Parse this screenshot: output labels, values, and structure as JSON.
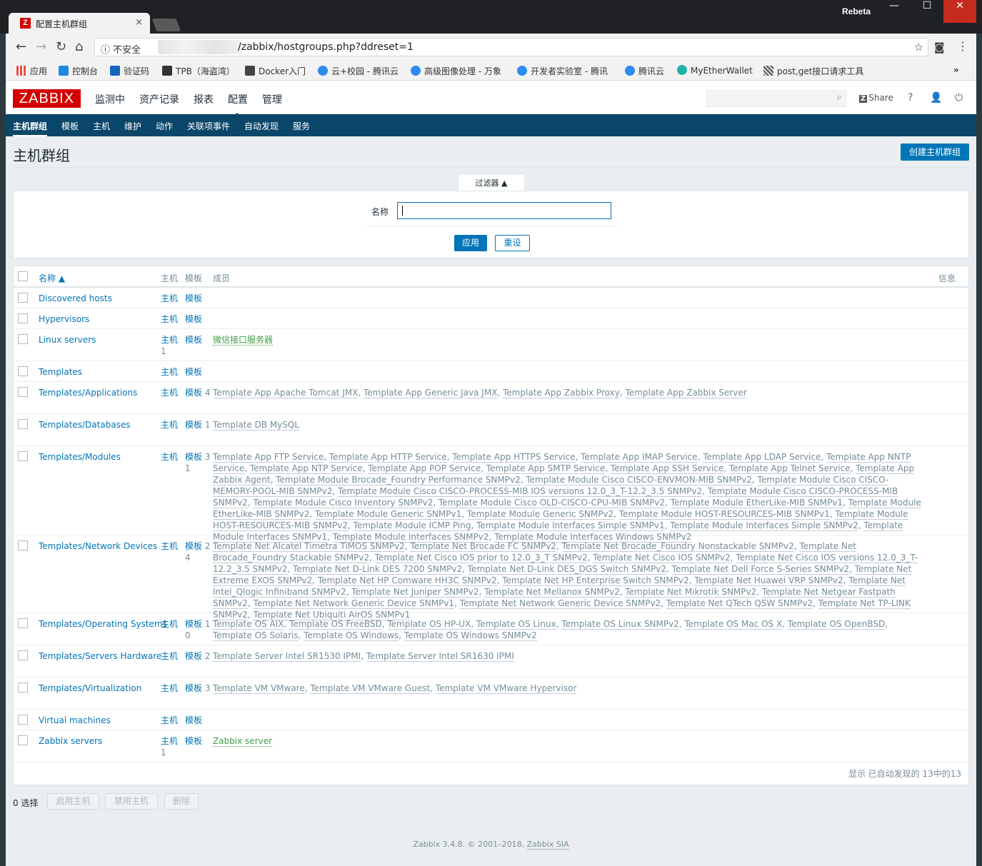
{
  "browser": {
    "tab_title": "配置主机群组",
    "tab_close": "×",
    "window_user": "Rebeta",
    "win_min": "—",
    "win_max": "☐",
    "win_close": "✕",
    "security_label": "不安全",
    "url": "/zabbix/hostgroups.php?ddreset=1",
    "bookmarks": [
      {
        "label": "应用",
        "color": "#e84a3c"
      },
      {
        "label": "控制台",
        "color": "#1e88e5"
      },
      {
        "label": "验证码",
        "color": "#1565c0"
      },
      {
        "label": "TPB（海盗湾）",
        "color": "#333333"
      },
      {
        "label": "Docker入门",
        "color": "#444444"
      },
      {
        "label": "云+校园 - 腾讯云",
        "color": "#2d8cf0"
      },
      {
        "label": "高级图像处理 - 万象",
        "color": "#2d8cf0"
      },
      {
        "label": "开发者实验室 - 腾讯",
        "color": "#2d8cf0"
      },
      {
        "label": "腾讯云",
        "color": "#2d8cf0"
      },
      {
        "label": "MyEtherWallet",
        "color": "#20b2aa"
      },
      {
        "label": "post,get接口请求工具",
        "color": "#555555"
      }
    ],
    "bookmarks_more": "»"
  },
  "header": {
    "logo": "ZABBIX",
    "menu": [
      "监测中",
      "资产记录",
      "报表",
      "配置",
      "管理"
    ],
    "active_menu": "配置",
    "share_badge": "Z",
    "share_label": "Share",
    "help": "?",
    "user": "👤",
    "logout": "⏻"
  },
  "subnav": {
    "items": [
      "主机群组",
      "模板",
      "主机",
      "维护",
      "动作",
      "关联项事件",
      "自动发现",
      "服务"
    ],
    "active": "主机群组"
  },
  "page": {
    "title": "主机群组",
    "create_button": "创建主机群组"
  },
  "filter": {
    "tab_label": "过滤器 ▲",
    "name_label": "名称",
    "name_value": "",
    "apply": "应用",
    "reset": "重设"
  },
  "table": {
    "headers": {
      "name": "名称 ▲",
      "hosts": "主机",
      "templates": "模板",
      "members": "成员",
      "info": "信息"
    },
    "rows": [
      {
        "name": "Discovered hosts",
        "hosts": "主机",
        "templates": "模板",
        "members": []
      },
      {
        "name": "Hypervisors",
        "hosts": "主机",
        "templates": "模板",
        "members": []
      },
      {
        "name": "Linux servers",
        "hosts": "主机",
        "host_count": "1",
        "templates": "模板",
        "members": [
          "微信接口服务器"
        ],
        "green": true
      },
      {
        "name": "Templates",
        "hosts": "主机",
        "templates": "模板",
        "members": []
      },
      {
        "name": "Templates/Applications",
        "hosts": "主机",
        "templates": "模板",
        "tpl_count": "4",
        "members": [
          "Template App Apache Tomcat JMX",
          "Template App Generic Java JMX",
          "Template App Zabbix Proxy",
          "Template App Zabbix Server"
        ]
      },
      {
        "name": "Templates/Databases",
        "hosts": "主机",
        "templates": "模板",
        "tpl_count": "1",
        "members": [
          "Template DB MySQL"
        ]
      },
      {
        "name": "Templates/Modules",
        "hosts": "主机",
        "templates": "模板",
        "tpl_count": "31",
        "members": [
          "Template App FTP Service",
          "Template App HTTP Service",
          "Template App HTTPS Service",
          "Template App IMAP Service",
          "Template App LDAP Service",
          "Template App NNTP Service",
          "Template App NTP Service",
          "Template App POP Service",
          "Template App SMTP Service",
          "Template App SSH Service",
          "Template App Telnet Service",
          "Template App Zabbix Agent",
          "Template Module Brocade_Foundry Performance SNMPv2",
          "Template Module Cisco CISCO-ENVMON-MIB SNMPv2",
          "Template Module Cisco CISCO-MEMORY-POOL-MIB SNMPv2",
          "Template Module Cisco CISCO-PROCESS-MIB IOS versions 12.0_3_T-12.2_3.5 SNMPv2",
          "Template Module Cisco CISCO-PROCESS-MIB SNMPv2",
          "Template Module Cisco Inventory SNMPv2",
          "Template Module Cisco OLD-CISCO-CPU-MIB SNMPv2",
          "Template Module EtherLike-MIB SNMPv1",
          "Template Module EtherLike-MIB SNMPv2",
          "Template Module Generic SNMPv1",
          "Template Module Generic SNMPv2",
          "Template Module HOST-RESOURCES-MIB SNMPv1",
          "Template Module HOST-RESOURCES-MIB SNMPv2",
          "Template Module ICMP Ping",
          "Template Module Interfaces Simple SNMPv1",
          "Template Module Interfaces Simple SNMPv2",
          "Template Module Interfaces SNMPv1",
          "Template Module Interfaces SNMPv2",
          "Template Module Interfaces Windows SNMPv2"
        ]
      },
      {
        "name": "Templates/Network Devices",
        "hosts": "主机",
        "templates": "模板",
        "tpl_count": "24",
        "members": [
          "Template Net Alcatel Timetra TiMOS SNMPv2",
          "Template Net Brocade FC SNMPv2",
          "Template Net Brocade_Foundry Nonstackable SNMPv2",
          "Template Net Brocade_Foundry Stackable SNMPv2",
          "Template Net Cisco IOS prior to 12.0_3_T SNMPv2",
          "Template Net Cisco IOS SNMPv2",
          "Template Net Cisco IOS versions 12.0_3_T-12.2_3.5 SNMPv2",
          "Template Net D-Link DES 7200 SNMPv2",
          "Template Net D-Link DES_DGS Switch SNMPv2",
          "Template Net Dell Force S-Series SNMPv2",
          "Template Net Extreme EXOS SNMPv2",
          "Template Net HP Comware HH3C SNMPv2",
          "Template Net HP Enterprise Switch SNMPv2",
          "Template Net Huawei VRP SNMPv2",
          "Template Net Intel_Qlogic Infiniband SNMPv2",
          "Template Net Juniper SNMPv2",
          "Template Net Mellanox SNMPv2",
          "Template Net Mikrotik SNMPv2",
          "Template Net Netgear Fastpath SNMPv2",
          "Template Net Network Generic Device SNMPv1",
          "Template Net Network Generic Device SNMPv2",
          "Template Net QTech QSW SNMPv2",
          "Template Net TP-LINK SNMPv2",
          "Template Net Ubiquiti AirOS SNMPv1"
        ]
      },
      {
        "name": "Templates/Operating Systems",
        "hosts": "主机",
        "templates": "模板",
        "tpl_count": "10",
        "members": [
          "Template OS AIX",
          "Template OS FreeBSD",
          "Template OS HP-UX",
          "Template OS Linux",
          "Template OS Linux SNMPv2",
          "Template OS Mac OS X",
          "Template OS OpenBSD",
          "Template OS Solaris",
          "Template OS Windows",
          "Template OS Windows SNMPv2"
        ]
      },
      {
        "name": "Templates/Servers Hardware",
        "hosts": "主机",
        "templates": "模板",
        "tpl_count": "2",
        "members": [
          "Template Server Intel SR1530 IPMI",
          "Template Server Intel SR1630 IPMI"
        ]
      },
      {
        "name": "Templates/Virtualization",
        "hosts": "主机",
        "templates": "模板",
        "tpl_count": "3",
        "members": [
          "Template VM VMware",
          "Template VM VMware Guest",
          "Template VM VMware Hypervisor"
        ]
      },
      {
        "name": "Virtual machines",
        "hosts": "主机",
        "templates": "模板",
        "members": []
      },
      {
        "name": "Zabbix servers",
        "hosts": "主机",
        "host_count": "1",
        "templates": "模板",
        "members": [
          "Zabbix server"
        ],
        "green": true
      }
    ],
    "footer": "显示 已自动发现的 13中的13"
  },
  "actions": {
    "selected": "0 选择",
    "enable": "启用主机",
    "disable": "禁用主机",
    "delete": "删除"
  },
  "footer": {
    "text": "Zabbix 3.4.8. © 2001–2018, ",
    "link": "Zabbix SIA"
  }
}
